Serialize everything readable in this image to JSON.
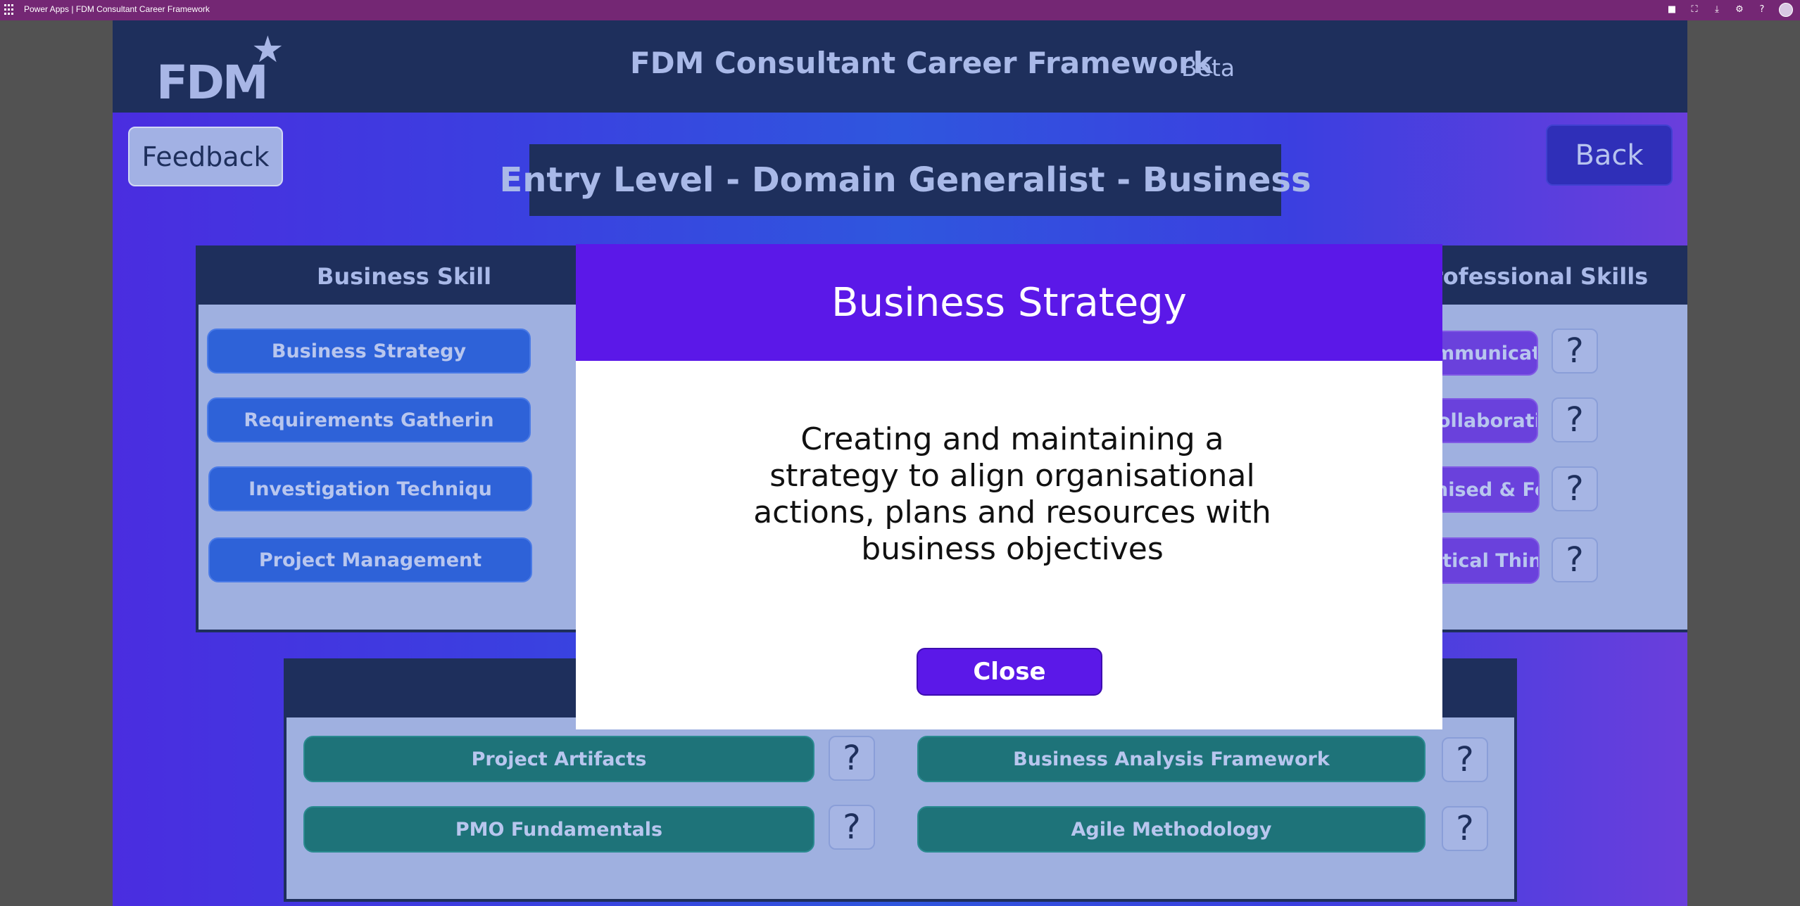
{
  "topbar": {
    "title": "Power Apps  |  FDM Consultant Career Framework",
    "icons": [
      "teams-icon",
      "fullscreen-icon",
      "download-icon",
      "settings-icon",
      "help-icon",
      "avatar"
    ]
  },
  "header": {
    "logo_text": "FDM",
    "title": "FDM Consultant Career Framework",
    "badge": "Beta"
  },
  "buttons": {
    "feedback": "Feedback",
    "back": "Back"
  },
  "level_title": "Entry Level - Domain Generalist - Business",
  "business_skills": {
    "title": "Business Skill",
    "items": [
      "Business Strategy",
      "Requirements Gatherin",
      "Investigation Techniqu",
      "Project Management"
    ]
  },
  "professional_skills": {
    "title": "rofessional Skills",
    "items": [
      "mmunication",
      "ollaboration",
      "nised & Focused",
      "itical Thinking"
    ],
    "help_label": "?"
  },
  "knowledge": {
    "items": [
      "Project Artifacts",
      "Business Analysis Framework",
      "PMO Fundamentals",
      "Agile Methodology"
    ],
    "help_label": "?"
  },
  "modal": {
    "title": "Business Strategy",
    "body": "Creating and maintaining a strategy to align organisational actions, plans and resources with business objectives",
    "close_label": "Close"
  },
  "colors": {
    "topbar": "#742774",
    "header": "#1e2f5c",
    "modal_accent": "#5b18e8",
    "business_skill": "#2e62d8",
    "professional_skill": "#6a41dc",
    "knowledge_skill": "#1e7379"
  }
}
